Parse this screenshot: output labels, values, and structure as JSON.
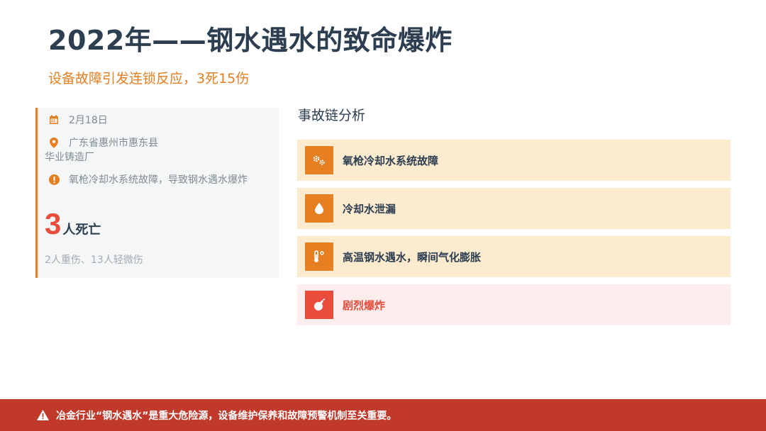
{
  "header": {
    "title": "2022年——钢水遇水的致命爆炸",
    "subtitle": "设备故障引发连锁反应，3死15伤"
  },
  "info_card": {
    "date": "2月18日",
    "location_line1": "广东省惠州市惠东县",
    "location_line2": "华业铸造厂",
    "cause": "氧枪冷却水系统故障，导致钢水遇水爆炸",
    "death_count": "3",
    "death_label": "人死亡",
    "injuries": "2人重伤、13人轻微伤",
    "icons": [
      "calendar-icon",
      "location-pin-icon",
      "exclamation-circle-icon"
    ],
    "accent_color": "#e67e22"
  },
  "chain": {
    "title": "事故链分析",
    "items": [
      {
        "label": "氧枪冷却水系统故障",
        "icon": "gears-icon",
        "style": "orange"
      },
      {
        "label": "冷却水泄漏",
        "icon": "water-drop-icon",
        "style": "orange"
      },
      {
        "label": "高温钢水遇水，瞬间气化膨胀",
        "icon": "thermometer-icon",
        "style": "orange"
      },
      {
        "label": "剧烈爆炸",
        "icon": "bomb-icon",
        "style": "red"
      }
    ]
  },
  "footer": {
    "text": "冶金行业“钢水遇水”是重大危险源，设备维护保养和故障预警机制至关重要。",
    "icon": "warning-triangle-icon",
    "color": "#c0392b"
  }
}
